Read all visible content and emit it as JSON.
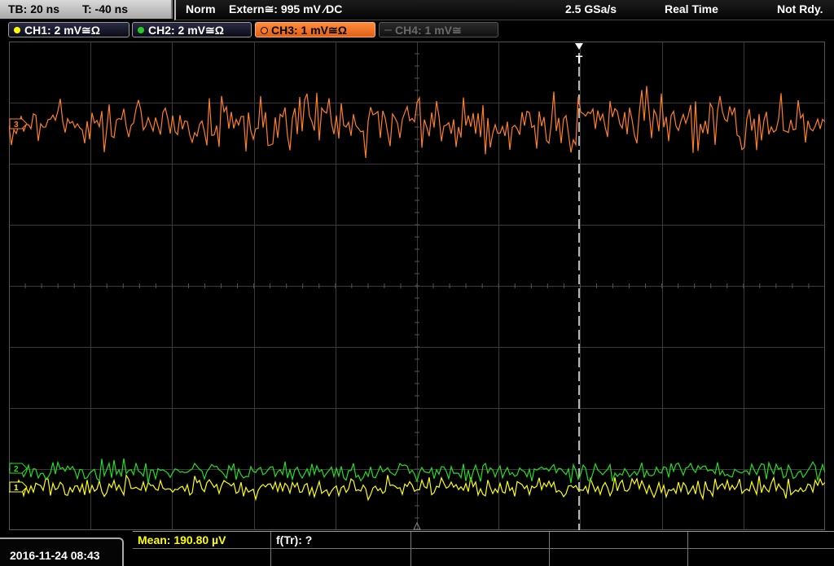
{
  "timebase": {
    "tb": "TB: 20 ns",
    "t": "T: -40 ns"
  },
  "status": {
    "mode": "Norm",
    "trigger": "Extern≅: 995 mV ⁄DC",
    "sample_rate": "2.5 GSa/s",
    "acq_mode": "Real Time",
    "state": "Not Rdy."
  },
  "channels": [
    {
      "label": "CH1: 2 mV≅Ω",
      "color": "#ffff00",
      "state": "on"
    },
    {
      "label": "CH2: 2 mV≅Ω",
      "color": "#22cc22",
      "state": "on"
    },
    {
      "label": "CH3: 1 mV≅Ω",
      "color": "#ff7f24",
      "state": "active"
    },
    {
      "label": "CH4: 1 mV≅",
      "color": "#555555",
      "state": "off"
    }
  ],
  "markers": {
    "ch3": "3",
    "ch2": "2",
    "ch1": "1",
    "trigger": "T"
  },
  "traces": {
    "ch1_color": "#ffff00",
    "ch2_color": "#22dd22",
    "ch3_color": "#ff7f24",
    "grid_color": "#3a3a3a"
  },
  "datetime": "2016-11-24 08:43",
  "measurements": {
    "mean": "Mean: 190.80 µV",
    "freq": "f(Tr): ?"
  }
}
